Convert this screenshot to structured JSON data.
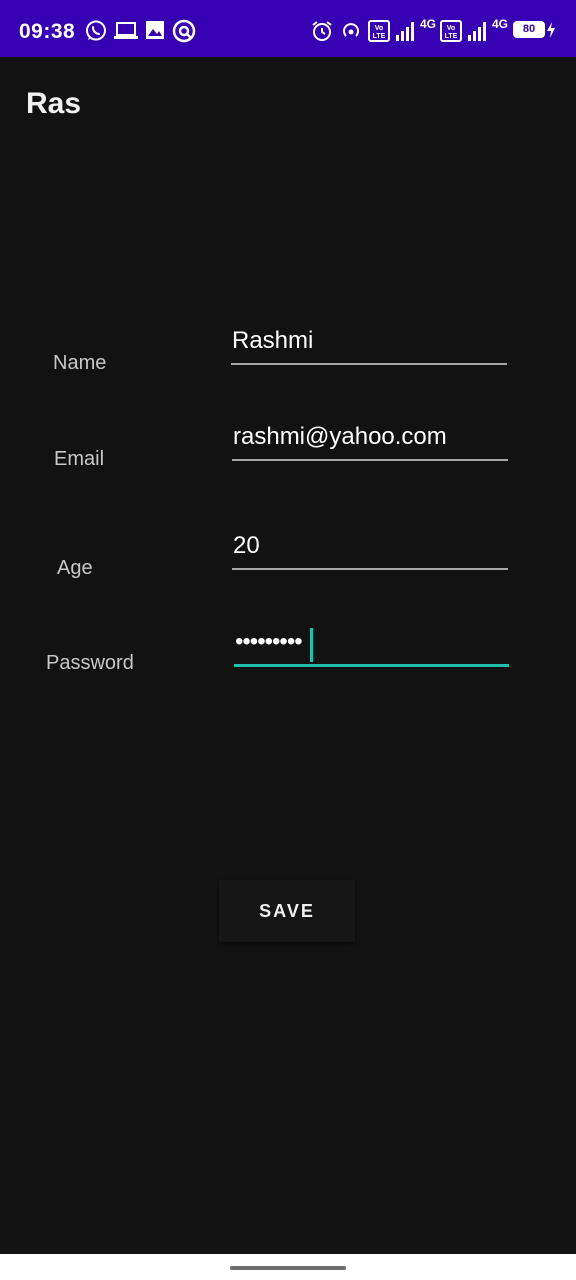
{
  "status_bar": {
    "time": "09:38",
    "battery": "80",
    "network_label_1": "4G",
    "network_label_2": "4G",
    "colors": {
      "background": "#3700b3"
    }
  },
  "app_bar": {
    "title": "Ras"
  },
  "form": {
    "name": {
      "label": "Name",
      "value": "Rashmi"
    },
    "email": {
      "label": "Email",
      "value": "rashmi@yahoo.com"
    },
    "age": {
      "label": "Age",
      "value": "20"
    },
    "password": {
      "label": "Password",
      "value": "•••••••••"
    }
  },
  "save_button": {
    "label": "SAVE"
  },
  "colors": {
    "accent": "#1fbfad",
    "background": "#121212"
  }
}
